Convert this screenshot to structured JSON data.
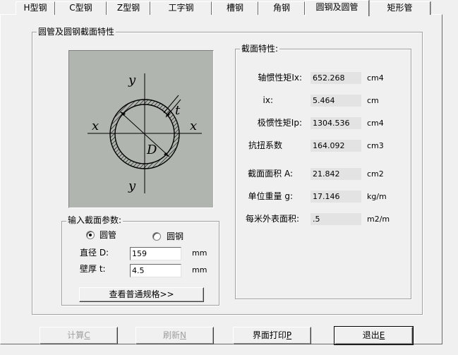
{
  "tabs": [
    {
      "label": "H型钢",
      "active": false
    },
    {
      "label": "C型钢",
      "active": false
    },
    {
      "label": "Z型钢",
      "active": false
    },
    {
      "label": "工字钢",
      "active": false
    },
    {
      "label": "槽钢",
      "active": false
    },
    {
      "label": "角钢",
      "active": false
    },
    {
      "label": "圆钢及圆管",
      "active": true
    },
    {
      "label": "矩形管",
      "active": false
    }
  ],
  "main_group": {
    "title": "圆管及圆钢截面特性"
  },
  "figure": {
    "axis_y_top": "y",
    "axis_y_bottom": "y",
    "axis_x_left": "x",
    "axis_x_right": "x",
    "label_t": "t",
    "label_d": "D",
    "fill_color": "#b0b6af"
  },
  "input_group": {
    "title": "输入截面参数:",
    "radio_tube": {
      "label": "圆管",
      "checked": true
    },
    "radio_bar": {
      "label": "圆钢",
      "checked": false
    },
    "diameter": {
      "label": "直径 D:",
      "value": "159",
      "unit": "mm"
    },
    "thickness": {
      "label": "壁厚 t:",
      "value": "4.5",
      "unit": "mm"
    },
    "spec_button": "查看普通规格>>"
  },
  "props_group": {
    "title": "截面特性:",
    "rows": [
      {
        "label": "轴惯性矩Ix:",
        "value": "652.268",
        "unit": "cm4"
      },
      {
        "label": "ix:",
        "value": "5.464",
        "unit": "cm"
      },
      {
        "label": "极惯性矩Ip:",
        "value": "1304.536",
        "unit": "cm4"
      },
      {
        "label": "抗扭系数",
        "value": "164.092",
        "unit": "cm3"
      },
      {
        "label": "截面面积 A:",
        "value": "21.842",
        "unit": "cm2"
      },
      {
        "label": "单位重量 g:",
        "value": "17.146",
        "unit": "kg/m"
      },
      {
        "label": "每米外表面积:",
        "value": ".5",
        "unit": "m2/m"
      }
    ]
  },
  "buttons": {
    "calc": {
      "label": "计算",
      "hotkey": "C",
      "enabled": false
    },
    "refresh": {
      "label": "刷新",
      "hotkey": "N",
      "enabled": false
    },
    "print": {
      "label": "界面打印",
      "hotkey": "P",
      "enabled": true
    },
    "exit": {
      "label": "退出",
      "hotkey": "E",
      "enabled": true
    }
  }
}
